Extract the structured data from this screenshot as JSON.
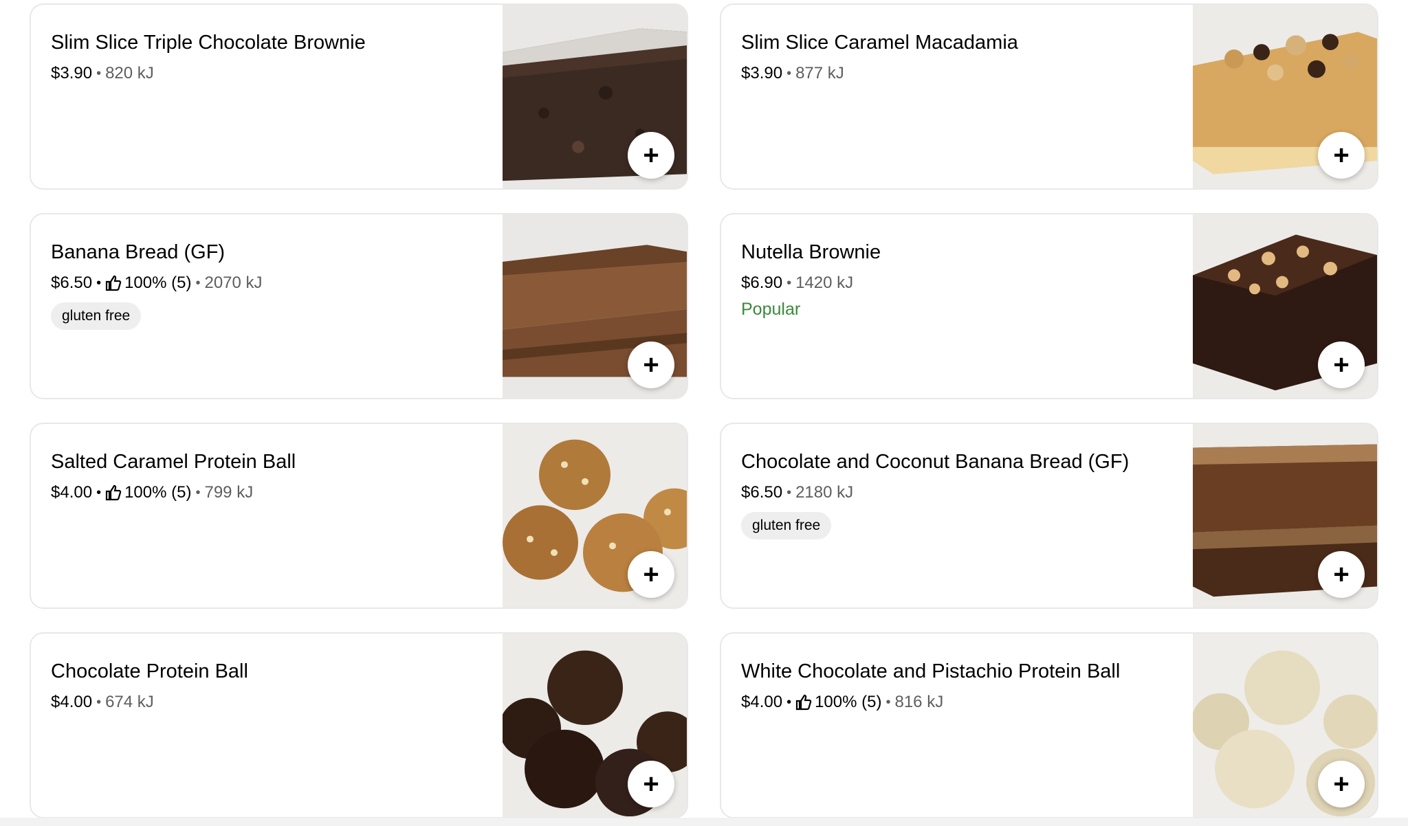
{
  "add_label": "+",
  "items": [
    {
      "name": "Slim Slice Triple Chocolate Brownie",
      "price": "$3.90",
      "energy": "820 kJ"
    },
    {
      "name": "Slim Slice Caramel Macadamia",
      "price": "$3.90",
      "energy": "877 kJ"
    },
    {
      "name": "Banana Bread (GF)",
      "price": "$6.50",
      "rating": "100% (5)",
      "energy": "2070 kJ",
      "badge": "gluten free"
    },
    {
      "name": "Nutella Brownie",
      "price": "$6.90",
      "energy": "1420 kJ",
      "tag": "Popular"
    },
    {
      "name": "Salted Caramel Protein Ball",
      "price": "$4.00",
      "rating": "100% (5)",
      "energy": "799 kJ"
    },
    {
      "name": "Chocolate and Coconut Banana Bread (GF)",
      "price": "$6.50",
      "energy": "2180 kJ",
      "badge": "gluten free"
    },
    {
      "name": "Chocolate Protein Ball",
      "price": "$4.00",
      "energy": "674 kJ"
    },
    {
      "name": "White Chocolate and Pistachio Protein Ball",
      "price": "$4.00",
      "rating": "100% (5)",
      "energy": "816 kJ"
    }
  ],
  "colors": {
    "popular": "#3a8a3a",
    "badge_bg": "#eeeeee",
    "border": "#e8e8e8",
    "muted": "#5e5e5e"
  }
}
